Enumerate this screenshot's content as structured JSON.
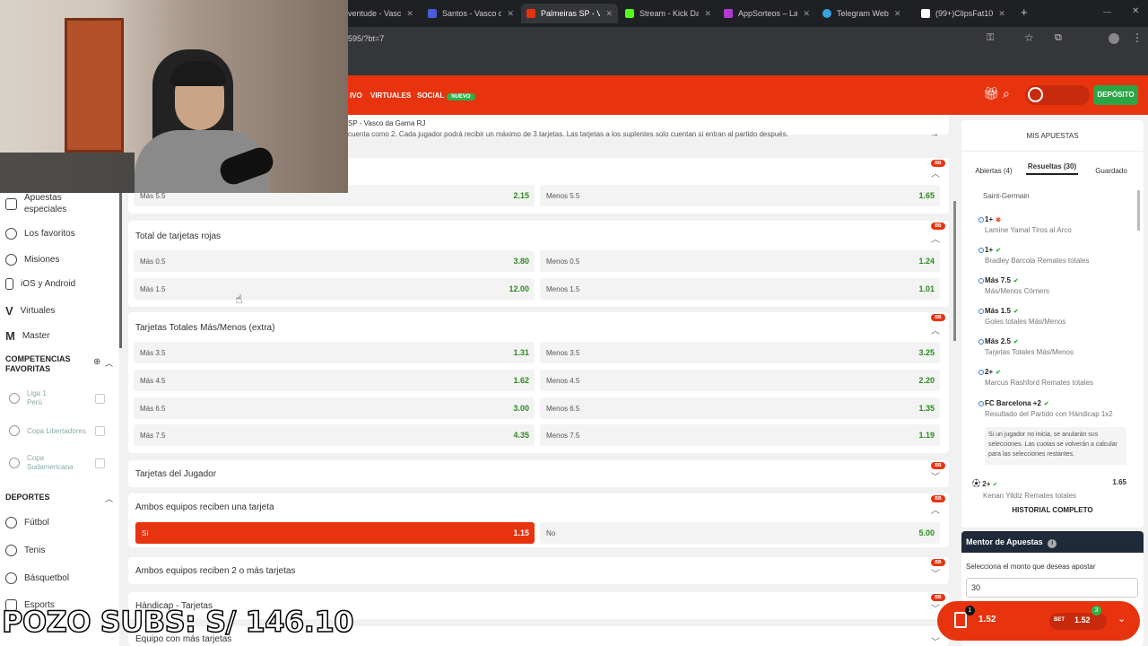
{
  "browser": {
    "tabs": [
      {
        "label": "ventude - Vasc",
        "color": "#ffffff"
      },
      {
        "label": "Santos - Vasco da",
        "color": "#4a5bd8"
      },
      {
        "label": "Palmeiras SP - Va",
        "color": "#e8330f"
      },
      {
        "label": "Stream - Kick Da",
        "color": "#53fc18"
      },
      {
        "label": "AppSorteos – La",
        "color": "#b33ad1"
      },
      {
        "label": "Telegram Web",
        "color": "#3aa0e0"
      },
      {
        "label": "(99+)ClipsFat10",
        "color": "#ffffff"
      }
    ],
    "url": "595/?bt=7",
    "new_tab": "+"
  },
  "header": {
    "nav": [
      "IVO",
      "VIRTUALES",
      "SOCIAL"
    ],
    "nuevo_badge": "NUEVO",
    "deposit": "DEPÓSITO",
    "accent": "#e8330f"
  },
  "sidebar": {
    "items": [
      "Apuestas especiales",
      "Los favoritos",
      "Misiones",
      "iOS y Android",
      "Virtuales",
      "Master"
    ],
    "competencias_title": "COMPETENCIAS FAVORITAS",
    "competencias": [
      {
        "name": "Liga 1",
        "country": "Perú"
      },
      {
        "name": "Copa Libertadores",
        "country": ""
      },
      {
        "name": "Copa Sudamericana",
        "country": ""
      }
    ],
    "deportes_title": "DEPORTES",
    "deportes": [
      "Fútbol",
      "Tenis",
      "Básquetbol",
      "Esports"
    ]
  },
  "main": {
    "info_match": "SP - Vasco da Gama RJ",
    "info_text": "cuenta como 2. Cada jugador podrá recibir un máximo de 3 tarjetas. Las tarjetas a los suplentes solo cuentan si entran al partido después.",
    "top_row": {
      "left_label": "Más 5.5",
      "left_odd": "2.15",
      "right_label": "Menos 5.5",
      "right_odd": "1.65"
    },
    "markets": [
      {
        "title": "Total de tarjetas rojas",
        "rows": [
          {
            "left_label": "Más 0.5",
            "left_odd": "3.80",
            "right_label": "Menos 0.5",
            "right_odd": "1.24"
          },
          {
            "left_label": "Más 1.5",
            "left_odd": "12.00",
            "right_label": "Menos 1.5",
            "right_odd": "1.01"
          }
        ]
      },
      {
        "title": "Tarjetas Totales Más/Menos (extra)",
        "rows": [
          {
            "left_label": "Más 3.5",
            "left_odd": "1.31",
            "right_label": "Menos 3.5",
            "right_odd": "3.25"
          },
          {
            "left_label": "Más 4.5",
            "left_odd": "1.62",
            "right_label": "Menos 4.5",
            "right_odd": "2.20"
          },
          {
            "left_label": "Más 6.5",
            "left_odd": "3.00",
            "right_label": "Menos 6.5",
            "right_odd": "1.35"
          },
          {
            "left_label": "Más 7.5",
            "left_odd": "4.35",
            "right_label": "Menos 7.5",
            "right_odd": "1.19"
          }
        ]
      }
    ],
    "jugador_title": "Tarjetas del Jugador",
    "ambos_title": "Ambos equipos reciben una tarjeta",
    "ambos_row": {
      "left_label": "Sí",
      "left_odd": "1.15",
      "right_label": "No",
      "right_odd": "5.00"
    },
    "ambos2_title": "Ambos equipos reciben 2 o más tarjetas",
    "handicap_title": "Hándicap - Tarjetas",
    "equipo_title": "Equipo con más tarjetas",
    "bb_badge": "BB"
  },
  "mis_apuestas": {
    "title": "MIS APUESTAS",
    "tabs": [
      "Abiertas (4)",
      "Resueltas (30)",
      "Guardado"
    ],
    "header_text": "Saint-Germain",
    "bets": [
      {
        "pick": "1+",
        "desc": "Lamine Yamal Tiros al Arco",
        "status": "lost"
      },
      {
        "pick": "1+",
        "desc": "Bradley Barcola Remates totales",
        "status": "won"
      },
      {
        "pick": "Más 7.5",
        "desc": "Más/Menos Córners",
        "status": "won"
      },
      {
        "pick": "Más 1.5",
        "desc": "Goles totales Más/Menos",
        "status": "won"
      },
      {
        "pick": "Más 2.5",
        "desc": "Tarjetas Totales Más/Menos",
        "status": "won"
      },
      {
        "pick": "2+",
        "desc": "Marcus Rashford Remates totales",
        "status": "won"
      },
      {
        "pick": "FC Barcelona +2",
        "desc": "Resultado del Partido con Hándicap 1x2",
        "status": "won"
      }
    ],
    "note": "Si un jugador no inicia, se anularán sus selecciones. Las cuotas se volverán a calcular para las selecciones restantes.",
    "last_pick": "2+",
    "last_desc": "Kenan Yildiz Remates totales",
    "last_odd": "1.65",
    "history": "HISTORIAL COMPLETO"
  },
  "mentor": {
    "title": "Mentor de Apuestas",
    "prompt": "Selecciona el monto que deseas apostar",
    "amount": "30"
  },
  "betslip": {
    "count": "1",
    "odd": "1.52",
    "badge": "3",
    "odd2": "1.52"
  },
  "overlay": {
    "pozo": "POZO SUBS: S/ 146.10"
  }
}
